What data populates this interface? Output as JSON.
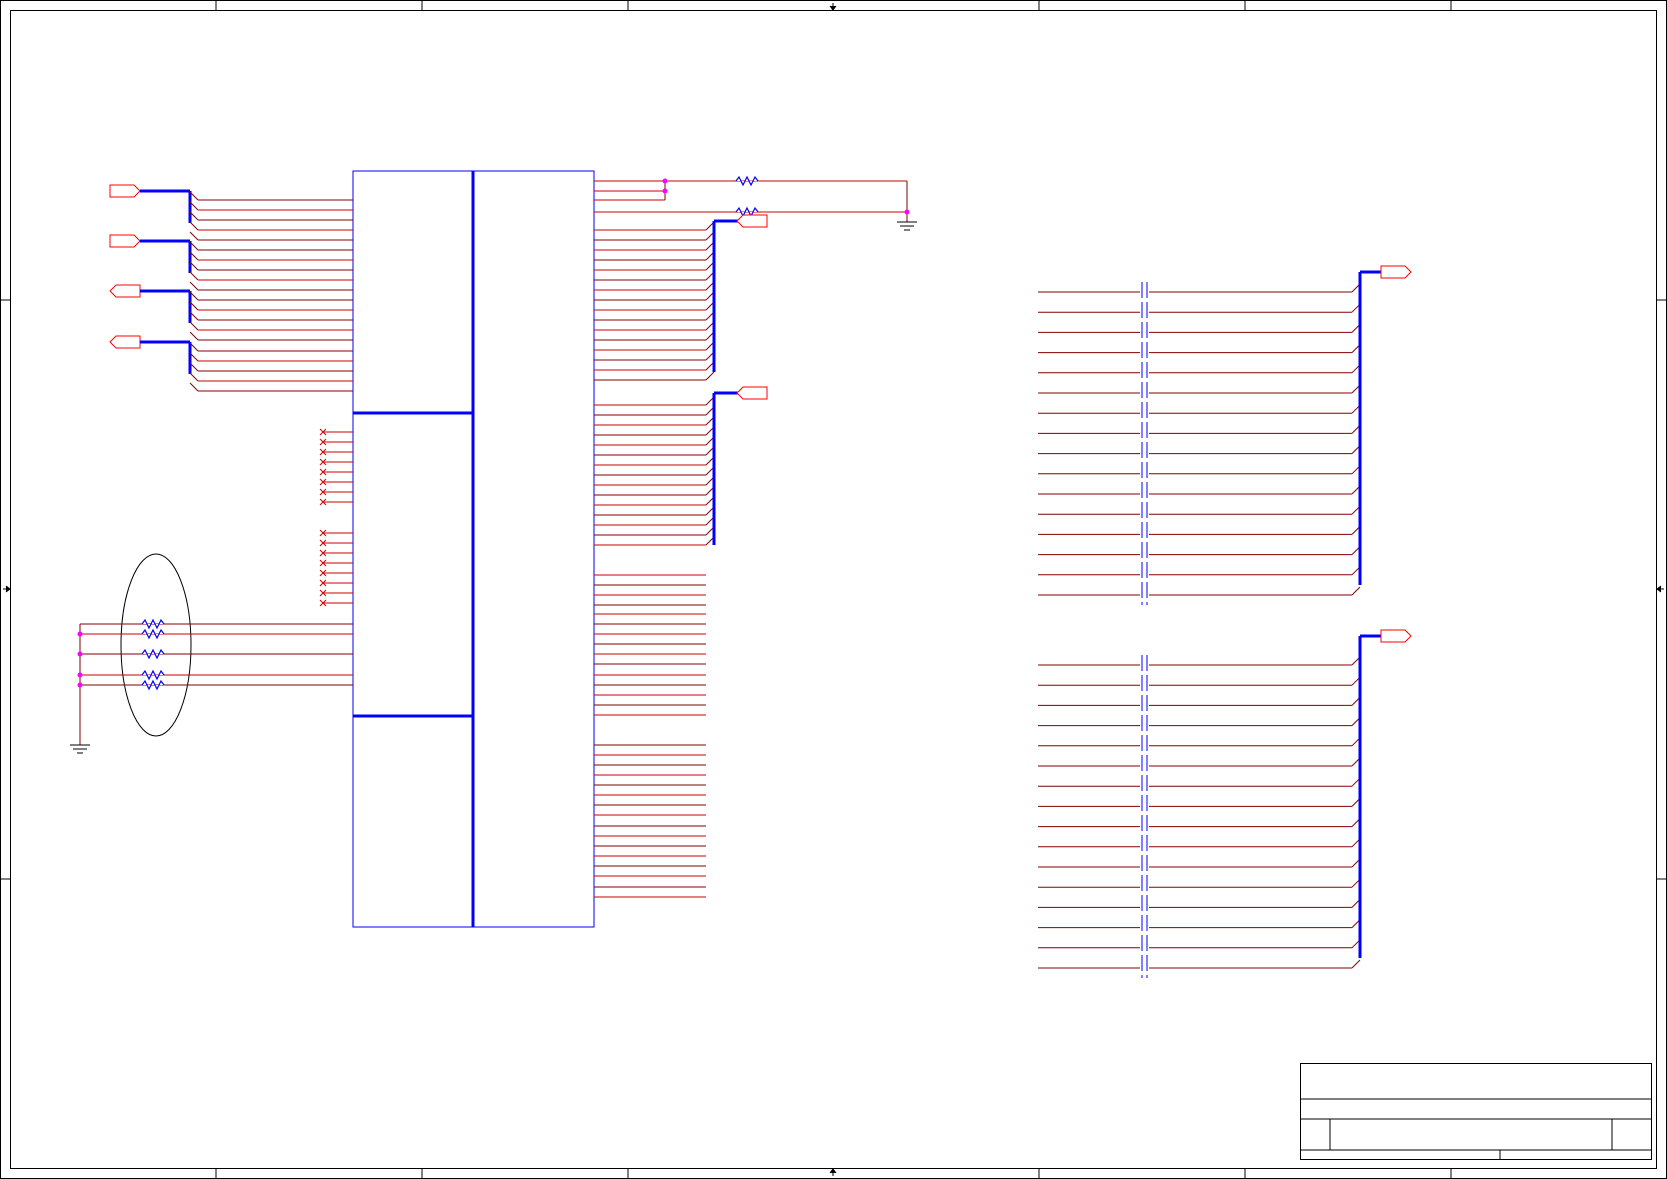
{
  "colors": {
    "background": "#ffffff",
    "frame": "#000000",
    "component_outline": "#0000ff",
    "bus": "#0000ff",
    "wire": "#cc0000",
    "wire_alt": "#800000",
    "port": "#ff0000",
    "junction": "#ff00ff",
    "resistor": "#0000ff",
    "annotation": "#000000"
  },
  "icons": {
    "port": "pentagon-port-icon",
    "ground": "ground-symbol-icon",
    "resistor": "zigzag-resistor-icon",
    "junction": "junction-dot-icon",
    "no_connect": "no-connect-x-icon",
    "capacitor": "capacitor-icon"
  },
  "title_block": {
    "title": "",
    "size": "",
    "number": "",
    "revision": "",
    "date": "",
    "sheet": ""
  }
}
